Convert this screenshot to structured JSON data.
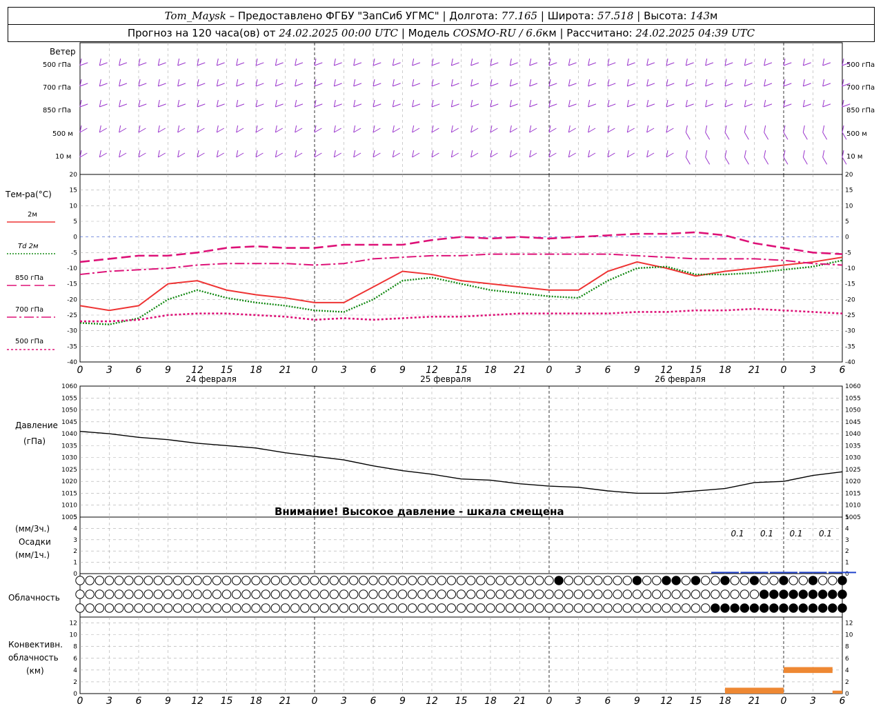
{
  "header": {
    "station": "Tom_Maysk",
    "provider": "Предоставлено ФГБУ \"ЗапСиб УГМС\"",
    "lon_label": "Долгота:",
    "lon": "77.165",
    "lat_label": "Широта:",
    "lat": "57.518",
    "alt_label": "Высота:",
    "alt": "143",
    "alt_unit": "м",
    "forecast_label": "Прогноз на 120 часа(ов) от",
    "forecast_time": "24.02.2025 00:00 UTC",
    "model_label": "Модель",
    "model": "COSMO-RU / 6.6",
    "model_unit": "км",
    "calc_label": "Рассчитано:",
    "calc_time": "24.02.2025 04:39 UTC"
  },
  "wind_panel": {
    "title": "Ветер",
    "levels": [
      "500 гПа",
      "700 гПа",
      "850 гПа",
      "500 м",
      "10 м"
    ],
    "color": "#9933cc"
  },
  "temp_panel": {
    "title": "Тем-ра(°C)",
    "legend": [
      {
        "label": "2м",
        "color": "#ee3333",
        "style": "solid"
      },
      {
        "label": "Td  2м",
        "color": "#118811",
        "style": "dotted"
      },
      {
        "label": "850 гПа",
        "color": "#dd1177",
        "style": "dash"
      },
      {
        "label": "700 гПа",
        "color": "#dd1177",
        "style": "dashdot"
      },
      {
        "label": "500 гПа",
        "color": "#dd1177",
        "style": "dot"
      }
    ]
  },
  "pressure_panel": {
    "title": "Давление",
    "unit": "(гПа)"
  },
  "warning": "Внимание! Высокое давление - шкала смещена",
  "precip_panel": {
    "unit3": "(мм/3ч.)",
    "title": "Осадки",
    "unit1": "(мм/1ч.)",
    "labels": [
      "0.1",
      "0.1",
      "0.1",
      "0.1"
    ]
  },
  "cloud_panel": {
    "title": "Облачность"
  },
  "conv_panel": {
    "title1": "Конвективн.",
    "title2": "облачность",
    "unit": "(км)"
  },
  "axis": {
    "hour_ticks": [
      "0",
      "3",
      "6",
      "9",
      "12",
      "15",
      "18",
      "21",
      "0",
      "3",
      "6",
      "9",
      "12",
      "15",
      "18",
      "21",
      "0",
      "3",
      "6",
      "9",
      "12",
      "15",
      "18",
      "21",
      "0",
      "3",
      "6"
    ],
    "days": [
      "24 февраля",
      "25 февраля",
      "26 февраля"
    ]
  },
  "chart_data": [
    {
      "type": "line",
      "name": "temperature",
      "x_hours": [
        0,
        3,
        6,
        9,
        12,
        15,
        18,
        21,
        24,
        27,
        30,
        33,
        36,
        39,
        42,
        45,
        48,
        51,
        54,
        57,
        60,
        63,
        66,
        69,
        72,
        75,
        78
      ],
      "ylim": [
        -40,
        20
      ],
      "yticks": [
        -40,
        -35,
        -30,
        -25,
        -20,
        -15,
        -10,
        -5,
        0,
        5,
        10,
        15,
        20
      ],
      "series": [
        {
          "name": "2м",
          "color": "#ee3333",
          "values": [
            -22,
            -23.5,
            -22,
            -15,
            -14,
            -17,
            -18.5,
            -19.5,
            -21,
            -21,
            -16,
            -11,
            -12,
            -14,
            -15,
            -16,
            -17,
            -17,
            -11,
            -8,
            -10,
            -12.5,
            -11,
            -10,
            -9,
            -8,
            -6.5
          ]
        },
        {
          "name": "Td 2м",
          "color": "#118811",
          "values": [
            -27.5,
            -28,
            -26,
            -20,
            -17,
            -19.5,
            -21,
            -22,
            -23.5,
            -24,
            -20,
            -14,
            -13,
            -15,
            -17,
            -18,
            -19,
            -19.5,
            -14,
            -10,
            -9.5,
            -12,
            -12,
            -11.5,
            -10.5,
            -9.5,
            -7.5
          ]
        },
        {
          "name": "850 гПа",
          "color": "#dd1177",
          "values": [
            -8,
            -7,
            -6,
            -6,
            -5,
            -3.5,
            -3,
            -3.5,
            -3.5,
            -2.5,
            -2.5,
            -2.5,
            -1,
            0,
            -0.5,
            0,
            -0.5,
            0,
            0.5,
            1,
            1,
            1.5,
            0.5,
            -2,
            -3.5,
            -5,
            -5.5
          ]
        },
        {
          "name": "700 гПа",
          "color": "#dd1177",
          "values": [
            -12,
            -11,
            -10.5,
            -10,
            -9,
            -8.5,
            -8.5,
            -8.5,
            -9,
            -8.5,
            -7,
            -6.5,
            -6,
            -6,
            -5.5,
            -5.5,
            -5.5,
            -5.5,
            -5.5,
            -6,
            -6.5,
            -7,
            -7,
            -7,
            -7.5,
            -8.5,
            -9
          ]
        },
        {
          "name": "500 гПа",
          "color": "#dd1177",
          "values": [
            -27,
            -27,
            -26.5,
            -25,
            -24.5,
            -24.5,
            -25,
            -25.5,
            -26.5,
            -26,
            -26.5,
            -26,
            -25.5,
            -25.5,
            -25,
            -24.5,
            -24.5,
            -24.5,
            -24.5,
            -24,
            -24,
            -23.5,
            -23.5,
            -23,
            -23.5,
            -24,
            -24.5
          ]
        }
      ]
    },
    {
      "type": "line",
      "name": "pressure",
      "x_hours": [
        0,
        3,
        6,
        9,
        12,
        15,
        18,
        21,
        24,
        27,
        30,
        33,
        36,
        39,
        42,
        45,
        48,
        51,
        54,
        57,
        60,
        63,
        66,
        69,
        72,
        75,
        78
      ],
      "ylim": [
        1005,
        1060
      ],
      "yticks": [
        1005,
        1010,
        1015,
        1020,
        1025,
        1030,
        1035,
        1040,
        1045,
        1050,
        1055,
        1060
      ],
      "series": [
        {
          "name": "",
          "color": "#000000",
          "values": [
            1041,
            1040,
            1038.5,
            1037.5,
            1036,
            1035,
            1034,
            1032,
            1030.5,
            1029,
            1026.5,
            1024.5,
            1023,
            1021,
            1020.5,
            1019,
            1018,
            1017.5,
            1016,
            1015,
            1015,
            1016,
            1017,
            1019.5,
            1020,
            1022.5,
            1024
          ]
        }
      ]
    },
    {
      "type": "bar",
      "name": "precipitation",
      "x_hours": [
        66,
        69,
        72,
        75,
        78
      ],
      "ylim": [
        0,
        5
      ],
      "yticks": [
        0,
        1,
        2,
        3,
        4,
        5
      ],
      "series": [
        {
          "name": "",
          "values": [
            0.1,
            0.1,
            0.1,
            0.1,
            0.1
          ]
        }
      ]
    },
    {
      "type": "bar",
      "name": "convective_cloud",
      "ylim": [
        0,
        13
      ],
      "yticks": [
        0,
        2,
        4,
        6,
        8,
        10,
        12
      ],
      "segments": [
        {
          "hours": [
            66,
            72
          ],
          "bottom": 0,
          "top": 1
        },
        {
          "hours": [
            72,
            77
          ],
          "bottom": 3.5,
          "top": 4.5
        },
        {
          "hours": [
            77,
            78
          ],
          "bottom": 0,
          "top": 0.5
        }
      ]
    },
    {
      "type": "table",
      "name": "cloud_cover",
      "rows": [
        {
          "from_hour": 55,
          "pattern": "partial"
        },
        {
          "from_hour": 70,
          "pattern": "full"
        },
        {
          "from_hour": 65,
          "pattern": "full"
        }
      ]
    }
  ]
}
